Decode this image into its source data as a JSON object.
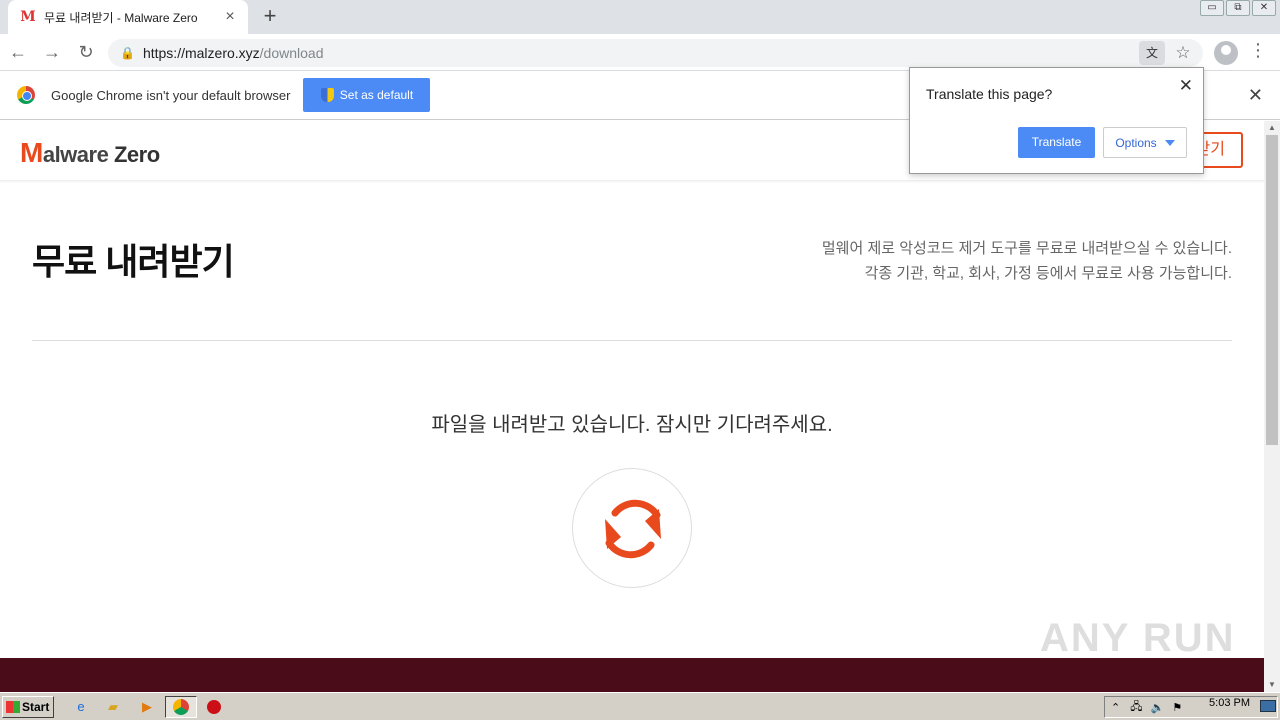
{
  "browser": {
    "tab_title": "무료 내려받기 - Malware Zero",
    "tab_favicon": "M",
    "url_host": "https://malzero.xyz",
    "url_path": "/download"
  },
  "infobar": {
    "message": "Google Chrome isn't your default browser",
    "button_label": "Set as default"
  },
  "translate_popup": {
    "title": "Translate this page?",
    "translate_label": "Translate",
    "options_label": "Options"
  },
  "site": {
    "logo_m": "M",
    "logo_alware": "alware",
    "logo_zero": "Zero",
    "header_button": "받기",
    "page_title": "무료 내려받기",
    "desc_line1": "멀웨어 제로 악성코드 제거 도구를 무료로 내려받으실 수 있습니다.",
    "desc_line2": "각종 기관, 학교, 회사, 가정 등에서 무료로 사용 가능합니다.",
    "waiting_message": "파일을 내려받고 있습니다. 잠시만 기다려주세요.",
    "accent_color": "#e84a1d"
  },
  "watermark": "ANY RUN",
  "taskbar": {
    "start_label": "Start",
    "clock": "5:03 PM"
  }
}
